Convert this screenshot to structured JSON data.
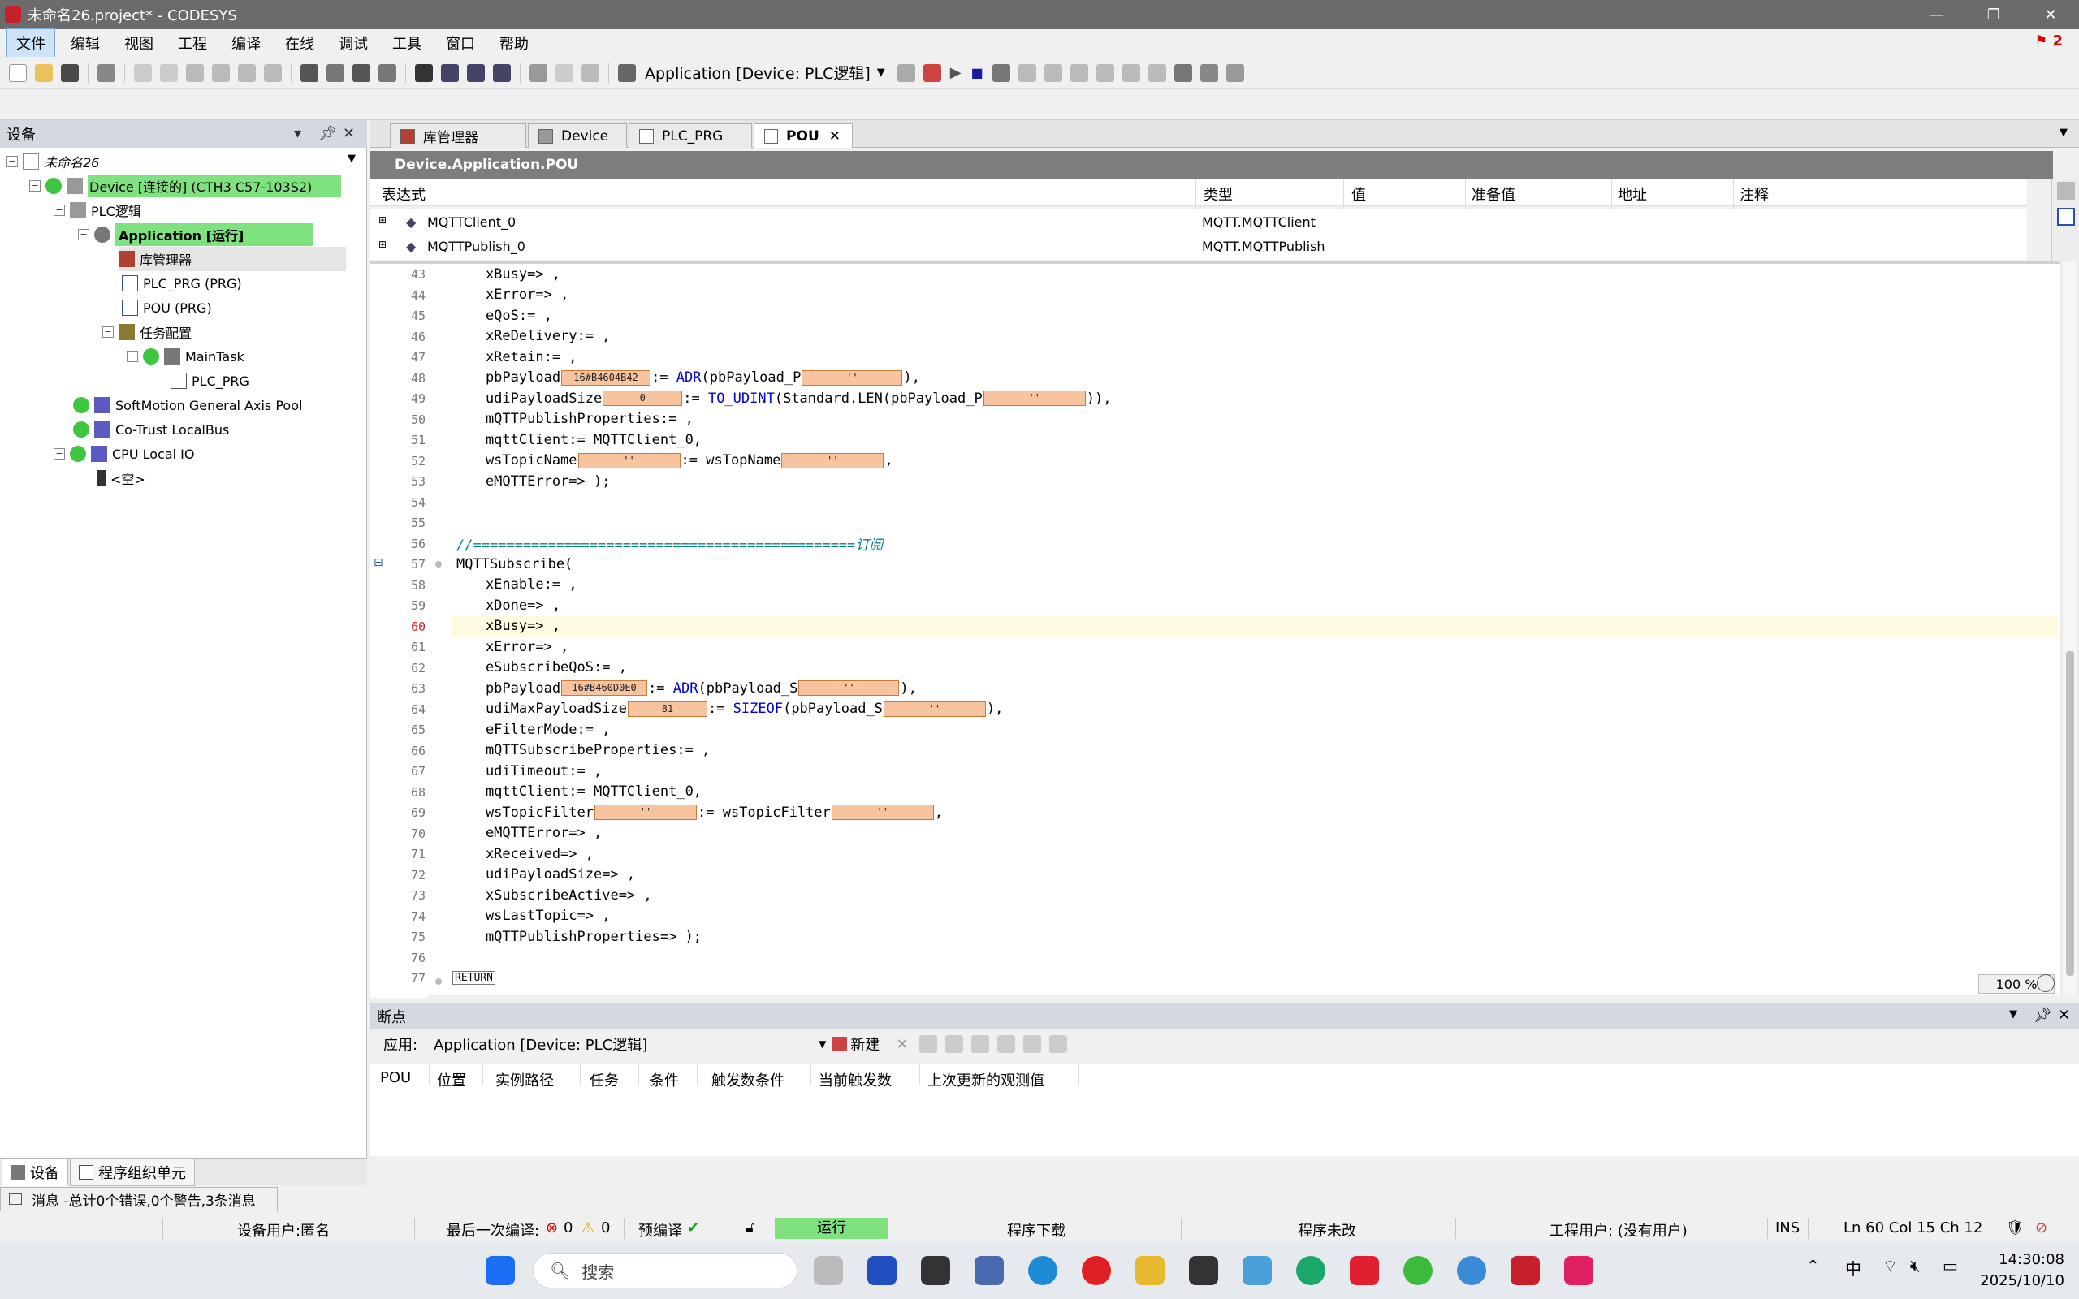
{
  "window": {
    "title": "未命名26.project* - CODESYS",
    "notification_count": "2"
  },
  "menu": [
    "文件",
    "编辑",
    "视图",
    "工程",
    "编译",
    "在线",
    "调试",
    "工具",
    "窗口",
    "帮助"
  ],
  "toolbar": {
    "application_selector": "Application [Device: PLC逻辑]"
  },
  "left_panel": {
    "title": "设备",
    "tree": [
      {
        "label": "未命名26"
      },
      {
        "label": "Device [连接的] (CTH3 C57-103S2)"
      },
      {
        "label": "PLC逻辑"
      },
      {
        "label": "Application [运行]"
      },
      {
        "label": "库管理器"
      },
      {
        "label": "PLC_PRG (PRG)"
      },
      {
        "label": "POU (PRG)"
      },
      {
        "label": "任务配置"
      },
      {
        "label": "MainTask"
      },
      {
        "label": "PLC_PRG"
      },
      {
        "label": "SoftMotion General Axis Pool"
      },
      {
        "label": "Co-Trust LocalBus"
      },
      {
        "label": "CPU Local IO"
      },
      {
        "label": "<空>"
      }
    ],
    "tabs": [
      "设备",
      "程序组织单元"
    ]
  },
  "editor": {
    "tabs": [
      "库管理器",
      "Device",
      "PLC_PRG",
      "POU"
    ],
    "pou_path": "Device.Application.POU",
    "watch_headers": [
      "表达式",
      "类型",
      "值",
      "准备值",
      "地址",
      "注释"
    ],
    "watch_rows": [
      {
        "name": "MQTTClient_0",
        "type": "MQTT.MQTTClient"
      },
      {
        "name": "MQTTPublish_0",
        "type": "MQTT.MQTTPublish"
      }
    ],
    "zoom": "100 %",
    "overlays": {
      "pbPayload_pub": "16#B4604B42",
      "udi_pub": "0",
      "pbPayload_sub": "16#B460D0E0",
      "udiMax": "81",
      "quote": "''"
    },
    "code": [
      {
        "n": "43",
        "t": "    xBusy=> ,"
      },
      {
        "n": "44",
        "t": "    xError=> ,"
      },
      {
        "n": "45",
        "t": "    eQoS:= ,"
      },
      {
        "n": "46",
        "t": "    xReDelivery:= ,"
      },
      {
        "n": "47",
        "t": "    xRetain:= ,"
      },
      {
        "n": "48",
        "t": ""
      },
      {
        "n": "49",
        "t": ""
      },
      {
        "n": "50",
        "t": "    mQTTPublishProperties:= ,"
      },
      {
        "n": "51",
        "t": "    mqttClient:= MQTTClient_0,"
      },
      {
        "n": "52",
        "t": ""
      },
      {
        "n": "53",
        "t": "    eMQTTError=> );"
      },
      {
        "n": "54",
        "t": ""
      },
      {
        "n": "55",
        "t": ""
      },
      {
        "n": "56",
        "t": "//==============================================订阅"
      },
      {
        "n": "57",
        "t": "MQTTSubscribe("
      },
      {
        "n": "58",
        "t": "    xEnable:= ,"
      },
      {
        "n": "59",
        "t": "    xDone=> ,"
      },
      {
        "n": "60",
        "t": "    xBusy=> ,"
      },
      {
        "n": "61",
        "t": "    xError=> ,"
      },
      {
        "n": "62",
        "t": "    eSubscribeQoS:= ,"
      },
      {
        "n": "63",
        "t": ""
      },
      {
        "n": "64",
        "t": ""
      },
      {
        "n": "65",
        "t": "    eFilterMode:= ,"
      },
      {
        "n": "66",
        "t": "    mQTTSubscribeProperties:= ,"
      },
      {
        "n": "67",
        "t": "    udiTimeout:= ,"
      },
      {
        "n": "68",
        "t": "    mqttClient:= MQTTClient_0,"
      },
      {
        "n": "69",
        "t": ""
      },
      {
        "n": "70",
        "t": "    eMQTTError=> ,"
      },
      {
        "n": "71",
        "t": "    xReceived=> ,"
      },
      {
        "n": "72",
        "t": "    udiPayloadSize=> ,"
      },
      {
        "n": "73",
        "t": "    xSubscribeActive=> ,"
      },
      {
        "n": "74",
        "t": "    wsLastTopic=> ,"
      },
      {
        "n": "75",
        "t": "    mQTTPublishProperties=> );"
      },
      {
        "n": "76",
        "t": ""
      },
      {
        "n": "77",
        "t": ""
      }
    ],
    "return_label": "RETURN"
  },
  "breakpoints": {
    "title": "断点",
    "app_label": "应用:",
    "app_value": "Application [Device: PLC逻辑]",
    "new_label": "新建",
    "columns": [
      "POU",
      "位置",
      "实例路径",
      "任务",
      "条件",
      "触发数条件",
      "当前触发数",
      "上次更新的观测值"
    ]
  },
  "messages": {
    "text": "消息 -总计0个错误,0个警告,3条消息"
  },
  "status": {
    "device_user": "设备用户:匿名",
    "last_compile": "最后一次编译:",
    "errors": "0",
    "warnings": "0",
    "precompile": "预编译",
    "run": "运行",
    "download": "程序下载",
    "unchanged": "程序未改",
    "project_user": "工程用户: (没有用户)",
    "ins": "INS",
    "position": "Ln 60  Col 15  Ch 12"
  },
  "taskbar": {
    "search": "搜索",
    "ime": "中",
    "time": "14:30:08",
    "date": "2025/10/10"
  },
  "colors": {
    "running_green": "#7ee27e",
    "titlebar": "#6b6b6b",
    "overlay": "#f8c4a0"
  }
}
